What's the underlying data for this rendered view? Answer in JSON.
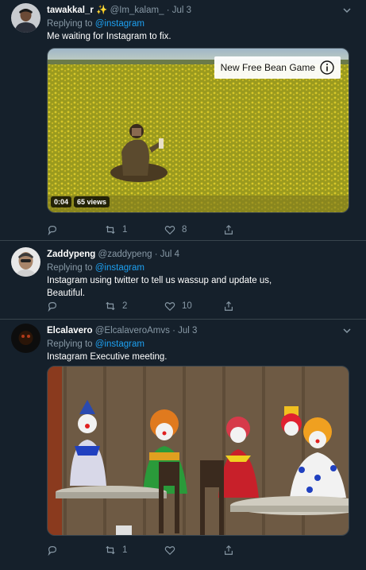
{
  "tweets": [
    {
      "name": "tawakkal_r",
      "emoji": "✨",
      "handle": "@Im_kalam_",
      "separator": "·",
      "date": "Jul 3",
      "replying_prefix": "Replying to",
      "replying_to": "@instagram",
      "text": "Me waiting for Instagram to fix.",
      "media": {
        "overlay_label": "New Free Bean Game",
        "duration": "0:04",
        "views": "65 views"
      },
      "retweets": "1",
      "likes": "8"
    },
    {
      "name": "Zaddypeng",
      "handle": "@zaddypeng",
      "separator": "·",
      "date": "Jul 4",
      "replying_prefix": "Replying to",
      "replying_to": "@instagram",
      "text_line1": "Instagram using twitter to tell us wassup and update us,",
      "text_line2": "Beautiful.",
      "retweets": "2",
      "likes": "10"
    },
    {
      "name": "Elcalavero",
      "handle": "@ElcalaveroAmvs",
      "separator": "·",
      "date": "Jul 3",
      "replying_prefix": "Replying to",
      "replying_to": "@instagram",
      "text": "Instagram Executive meeting.",
      "retweets": "1",
      "likes": ""
    }
  ],
  "colors": {
    "background": "#15202b",
    "border": "#38444d",
    "muted": "#8899a6",
    "link": "#1da1f2"
  },
  "icons": [
    "reply-icon",
    "retweet-icon",
    "like-icon",
    "share-icon",
    "chevron-down-icon",
    "info-icon"
  ]
}
